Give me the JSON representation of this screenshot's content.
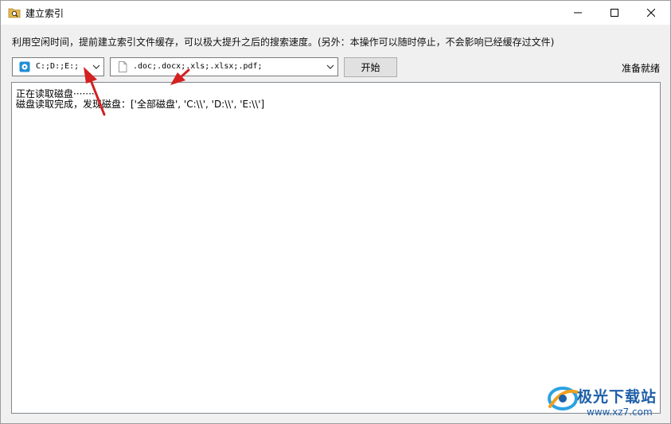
{
  "window": {
    "title": "建立索引"
  },
  "description": "利用空闲时间，提前建立索引文件缓存，可以极大提升之后的搜索速度。(另外：本操作可以随时停止，不会影响已经缓存过文件)",
  "drives_combo": {
    "value": "C:;D:;E:;",
    "icon": "drive-icon"
  },
  "types_combo": {
    "value": ".doc;.docx;.xls;.xlsx;.pdf;",
    "icon": "file-icon"
  },
  "start_button": {
    "label": "开始"
  },
  "status": "准备就绪",
  "log": {
    "lines": [
      "正在读取磁盘·······",
      "磁盘读取完成，发现磁盘：['全部磁盘', 'C:\\\\', 'D:\\\\', 'E:\\\\']"
    ]
  },
  "watermark": {
    "brand": "极光下载站",
    "url": "www.xz7.com"
  },
  "colors": {
    "annotation_arrow": "#d42020",
    "watermark": "#1e5fa8"
  }
}
